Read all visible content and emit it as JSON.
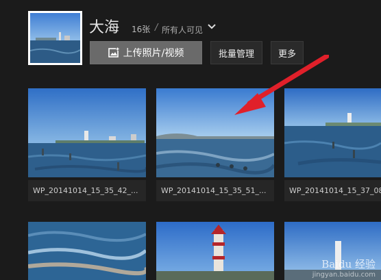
{
  "album": {
    "title": "大海",
    "count": "16张",
    "separator": "/",
    "visibility": "所有人可见"
  },
  "toolbar": {
    "upload_label": "上传照片/视频",
    "batch_label": "批量管理",
    "more_label": "更多"
  },
  "photos": [
    {
      "caption": "WP_20141014_15_35_42_..."
    },
    {
      "caption": "WP_20141014_15_35_51_..."
    },
    {
      "caption": "WP_20141014_15_37_08..."
    }
  ],
  "watermark": {
    "line1": "Baidu 经验",
    "line2": "jingyan.baidu.com"
  },
  "colors": {
    "background": "#1b1b1b",
    "arrow": "#e0202a"
  }
}
